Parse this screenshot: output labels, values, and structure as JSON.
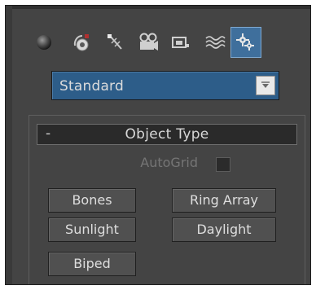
{
  "toolbar": {
    "tabs": [
      {
        "icon": "sphere-icon",
        "label": "Geometry"
      },
      {
        "icon": "shapes-icon",
        "label": "Shapes"
      },
      {
        "icon": "light-icon",
        "label": "Lights"
      },
      {
        "icon": "camera-icon",
        "label": "Cameras"
      },
      {
        "icon": "helper-icon",
        "label": "Helpers"
      },
      {
        "icon": "space-warp-icon",
        "label": "Space Warps"
      },
      {
        "icon": "systems-icon",
        "label": "Systems",
        "active": true
      }
    ]
  },
  "category_dropdown": {
    "value": "Standard"
  },
  "rollout": {
    "toggle": "-",
    "title": "Object Type",
    "autogrid": {
      "label": "AutoGrid",
      "checked": false,
      "enabled": false
    },
    "buttons": {
      "bones": "Bones",
      "ring_array": "Ring Array",
      "sunlight": "Sunlight",
      "daylight": "Daylight",
      "biped": "Biped"
    }
  },
  "colors": {
    "panel_bg": "#444444",
    "accent": "#2d5d89",
    "active_tab": "#3f6f9c",
    "text": "#dedede",
    "disabled_text": "#757575"
  }
}
